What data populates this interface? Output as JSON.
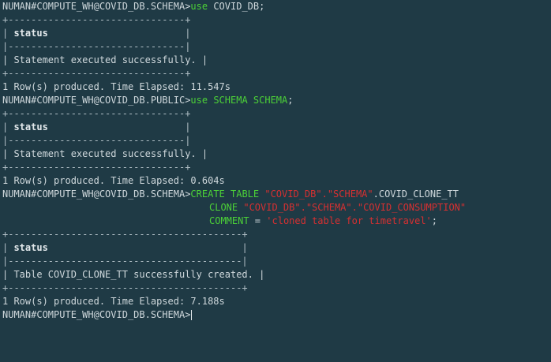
{
  "terminal": {
    "blocks": [
      {
        "prompt": "NUMAN#COMPUTE_WH@COVID_DB.SCHEMA>",
        "command": {
          "kw1": "use",
          "rest": " COVID_DB;"
        },
        "table": {
          "border": "+-------------------------------+",
          "header": "| status                        |",
          "divider": "|-------------------------------|",
          "row": "| Statement executed successfully. |",
          "bottom": "+-------------------------------+"
        },
        "result": "1 Row(s) produced. Time Elapsed: 11.547s"
      },
      {
        "prompt": "NUMAN#COMPUTE_WH@COVID_DB.PUBLIC>",
        "command": {
          "kw1": "use SCHEMA SCHEMA",
          "rest": ";"
        },
        "table": {
          "border": "+-------------------------------+",
          "header": "| status                        |",
          "divider": "|-------------------------------|",
          "row": "| Statement executed successfully. |",
          "bottom": "+-------------------------------+"
        },
        "result": "1 Row(s) produced. Time Elapsed: 0.604s"
      },
      {
        "prompt": "NUMAN#COMPUTE_WH@COVID_DB.SCHEMA>",
        "command": {
          "line1_kw": "CREATE TABLE ",
          "line1_str": "\"COVID_DB\".\"SCHEMA\"",
          "line1_rest": ".COVID_CLONE_TT",
          "line2_kw": "CLONE ",
          "line2_str": "\"COVID_DB\".\"SCHEMA\".\"COVID_CONSUMPTION\"",
          "line3_kw": "COMMENT",
          "line3_eq": " = ",
          "line3_str": "'cloned table for timetravel'",
          "line3_end": ";"
        },
        "table": {
          "border": "+-----------------------------------------+",
          "header": "| status                                  |",
          "divider": "|-----------------------------------------|",
          "row": "| Table COVID_CLONE_TT successfully created. |",
          "bottom": "+-----------------------------------------+"
        },
        "result": "1 Row(s) produced. Time Elapsed: 7.188s"
      }
    ],
    "final_prompt": "NUMAN#COMPUTE_WH@COVID_DB.SCHEMA>"
  },
  "colors": {
    "background": "#1f3a45",
    "text": "#cfd8dc",
    "keyword": "#4cd137",
    "string": "#d63031"
  }
}
